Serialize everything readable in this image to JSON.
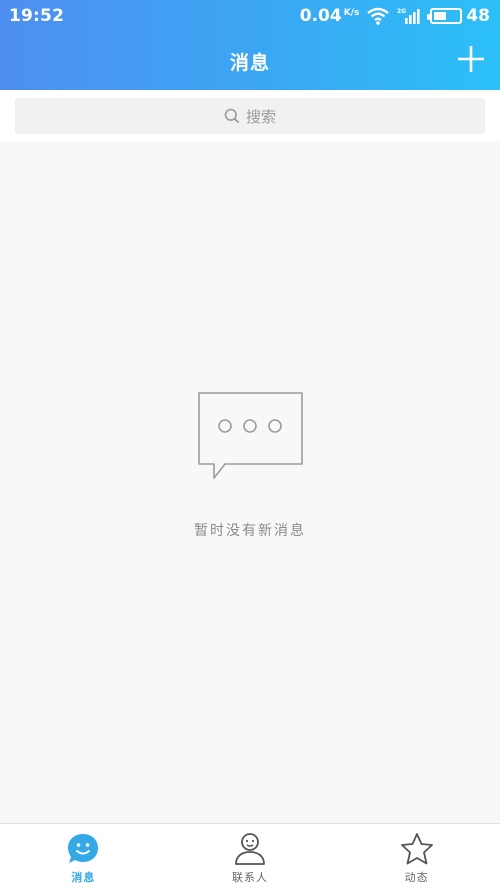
{
  "status_bar": {
    "time": "19:52",
    "speed_value": "0.04",
    "speed_unit": "K/s",
    "network_label": "2G",
    "battery_level": "48",
    "battery_fraction": 0.48
  },
  "header": {
    "title": "消息",
    "add_icon": "plus-icon"
  },
  "search": {
    "placeholder": "搜索",
    "icon": "search-icon"
  },
  "empty_state": {
    "icon": "chat-bubble-icon",
    "message": "暂时没有新消息"
  },
  "tabbar": {
    "active": "messages",
    "accent_color": "#35a8e8",
    "tabs": [
      {
        "id": "messages",
        "label": "消息",
        "icon": "smiley-chat-icon"
      },
      {
        "id": "contacts",
        "label": "联系人",
        "icon": "person-icon"
      },
      {
        "id": "moments",
        "label": "动态",
        "icon": "star-icon"
      }
    ]
  }
}
